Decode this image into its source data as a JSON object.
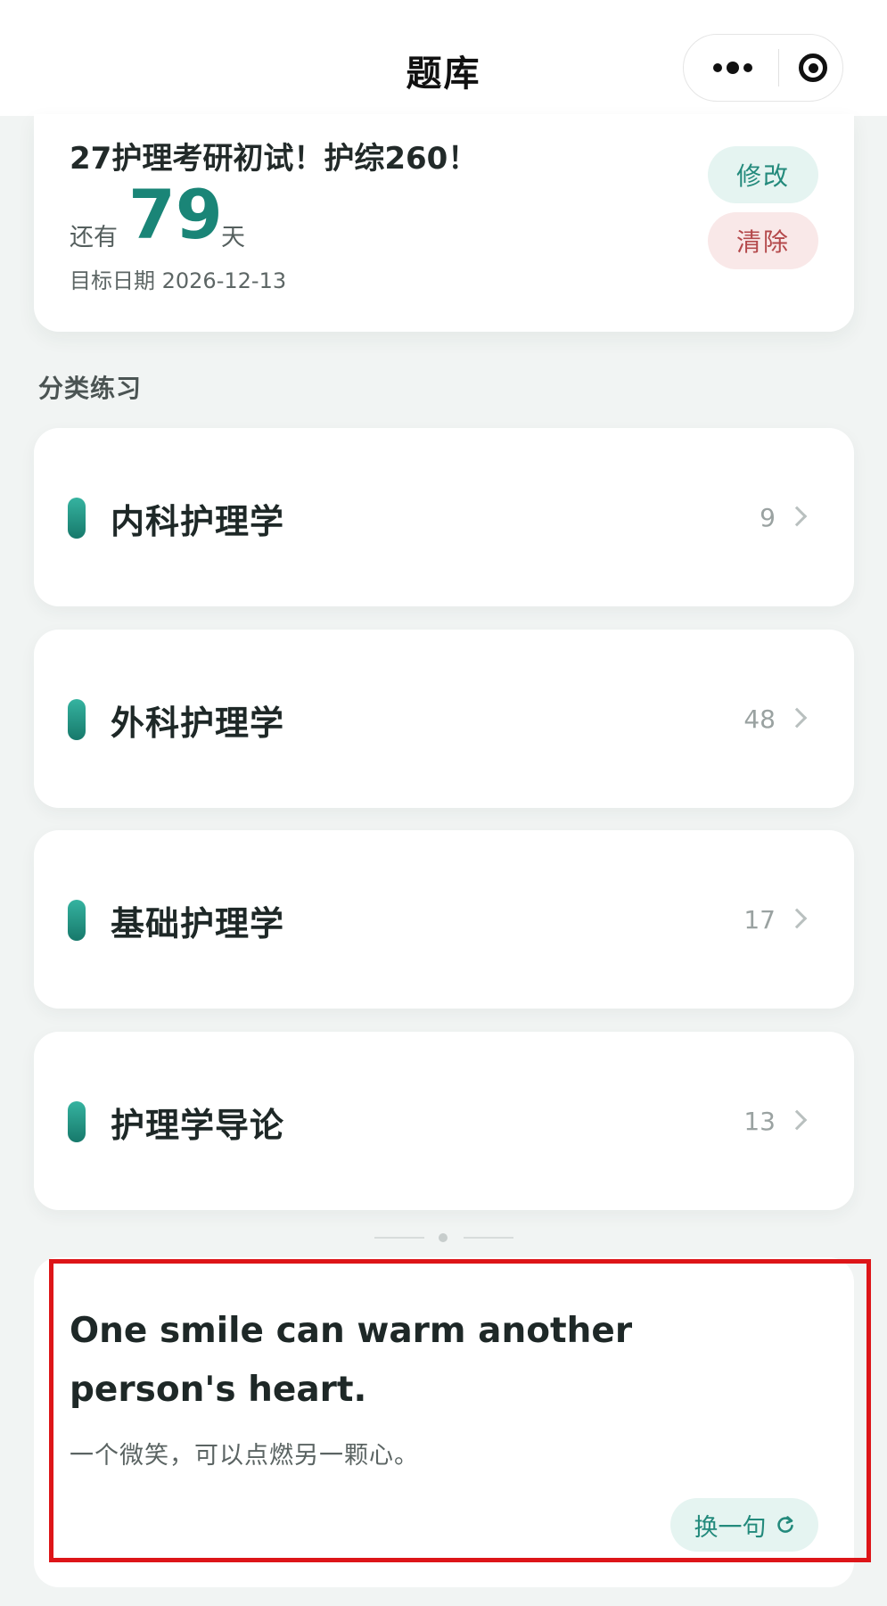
{
  "nav": {
    "title": "题库"
  },
  "goal": {
    "title": "27护理考研初试！护综260！",
    "remaining_prefix": "还有",
    "days_remaining": "79",
    "days_unit": "天",
    "target_date_text": "目标日期 2026-12-13",
    "edit_label": "修改",
    "clear_label": "清除"
  },
  "categories": {
    "section_title": "分类练习",
    "items": [
      {
        "name": "内科护理学",
        "count": "9"
      },
      {
        "name": "外科护理学",
        "count": "48"
      },
      {
        "name": "基础护理学",
        "count": "17"
      },
      {
        "name": "护理学导论",
        "count": "13"
      }
    ]
  },
  "quote": {
    "english": "One smile can warm another person's heart.",
    "chinese": "一个微笑，可以点燃另一颗心。",
    "refresh_label": "换一句"
  },
  "colors": {
    "accent": "#1a8577",
    "danger": "#b4494b",
    "highlight_border": "#dd1518"
  },
  "icons": {
    "more": "more-dots-icon",
    "close": "target-ring-icon",
    "chevron": "chevron-right-icon",
    "refresh": "refresh-icon"
  }
}
